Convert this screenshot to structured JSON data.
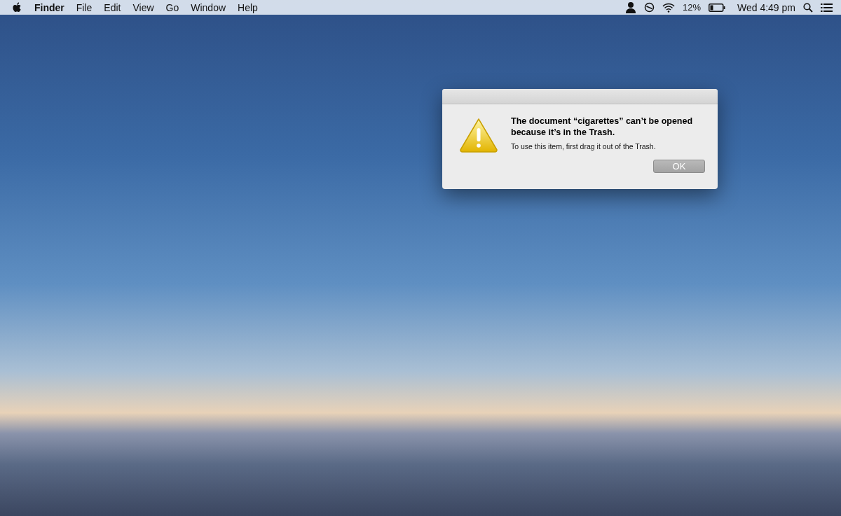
{
  "menu_bar": {
    "app_name": "Finder",
    "menus": [
      "File",
      "Edit",
      "View",
      "Go",
      "Window",
      "Help"
    ],
    "battery_percent": "12%",
    "clock": "Wed 4:49 pm"
  },
  "dialog": {
    "message": "The document “cigarettes” can’t be opened because it’s in the Trash.",
    "detail": "To use this item, first drag it out of the Trash.",
    "buttons": [
      "OK"
    ]
  }
}
